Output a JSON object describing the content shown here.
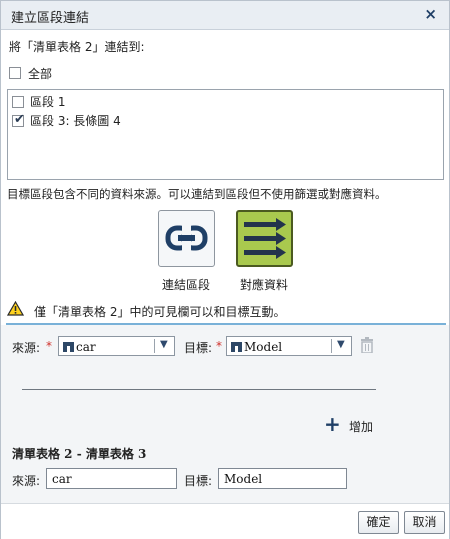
{
  "dialog": {
    "title": "建立區段連結",
    "close_label": "×"
  },
  "link_prompt": "將「清單表格 2」連結到:",
  "select_all_label": "全部",
  "sections": [
    {
      "label": "區段 1",
      "checked": false
    },
    {
      "label": "區段 3: 長條圖 4",
      "checked": true
    }
  ],
  "info_text": "目標區段包含不同的資料來源。可以連結到區段但不使用篩選或對應資料。",
  "mode_buttons": {
    "link_label": "連結區段",
    "map_label": "對應資料"
  },
  "warning_text": "僅「清單表格 2」中的可見欄可以和目標互動。",
  "mapping": {
    "source_label": "來源:",
    "target_label": "目標:",
    "required_mark": "*",
    "source_value": "car",
    "target_value": "Model"
  },
  "add_label": "增加",
  "existing_mapping": {
    "heading": "清單表格 2 - 清單表格 3",
    "source_label": "來源:",
    "target_label": "目標:",
    "source_value": "car",
    "target_value": "Model"
  },
  "footer": {
    "ok_label": "確定",
    "cancel_label": "取消"
  },
  "colors": {
    "accent": "#1f3f66",
    "map_button": "#a9c94e",
    "required": "#d0302a",
    "warning": "#e8b400"
  }
}
